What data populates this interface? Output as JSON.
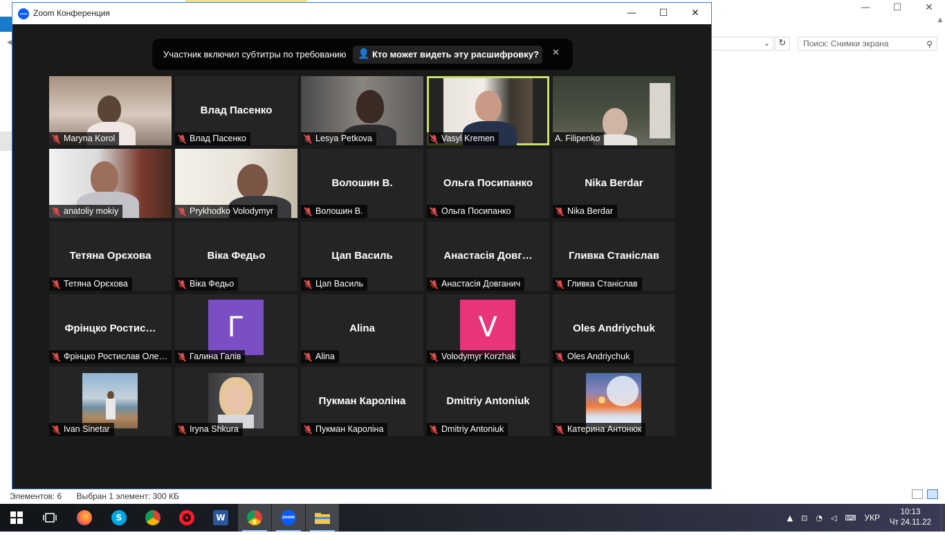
{
  "explorer": {
    "search_placeholder": "Поиск: Снимки экрана",
    "status_items": "Элементов: 6",
    "status_selected": "Выбран 1 элемент: 300 КБ",
    "window_controls": [
      "—",
      "☐",
      "✕"
    ]
  },
  "zoom": {
    "title": "Zoom Конференция",
    "logo_text": "zoom",
    "window_controls": [
      "—",
      "☐",
      "✕"
    ],
    "banner": {
      "text": "Участник включил субтитры по требованию",
      "button": "Кто может видеть эту расшифровку?",
      "close": "✕"
    },
    "participants": [
      {
        "label": "Maryna Korol",
        "tile": "video"
      },
      {
        "label": "Влад Пасенко",
        "display": "Влад Пасенко",
        "tile": "name"
      },
      {
        "label": "Lesya Petkova",
        "tile": "video"
      },
      {
        "label": "Vasyl Kremen",
        "tile": "video",
        "active": true
      },
      {
        "label": "A. Filipenko",
        "tile": "video"
      },
      {
        "label": "anatoliy mokiy",
        "tile": "video"
      },
      {
        "label": "Prykhodko Volodymyr",
        "tile": "video"
      },
      {
        "label": "Волошин В.",
        "display": "Волошин В.",
        "tile": "name"
      },
      {
        "label": "Ольга Посипанко",
        "display": "Ольга Посипанко",
        "tile": "name"
      },
      {
        "label": "Nika Berdar",
        "display": "Nika Berdar",
        "tile": "name"
      },
      {
        "label": "Тетяна Орєхова",
        "display": "Тетяна Орєхова",
        "tile": "name"
      },
      {
        "label": "Віка Федьо",
        "display": "Віка Федьо",
        "tile": "name"
      },
      {
        "label": "Цап Василь",
        "display": "Цап Василь",
        "tile": "name"
      },
      {
        "label": "Анастасія Довганич",
        "display": "Анастасія Довг…",
        "tile": "name"
      },
      {
        "label": "Гливка Станіслав",
        "display": "Гливка Станіслав",
        "tile": "name"
      },
      {
        "label": "Фрінцко Ростислав Оле…",
        "display": "Фрінцко  Ростис…",
        "tile": "name"
      },
      {
        "label": "Галина Галів",
        "letter": "Г",
        "color": "#7b4fc4",
        "tile": "letter"
      },
      {
        "label": "Alina",
        "display": "Alina",
        "tile": "name"
      },
      {
        "label": "Volodymyr Korzhak",
        "letter": "V",
        "color": "#e8357a",
        "tile": "letter"
      },
      {
        "label": "Oles Andriychuk",
        "display": "Oles Andriychuk",
        "tile": "name"
      },
      {
        "label": "Ivan Sinetar",
        "tile": "photo"
      },
      {
        "label": "Iryna Shkura",
        "tile": "photo"
      },
      {
        "label": "Пукман Кароліна",
        "display": "Пукман Кароліна",
        "tile": "name"
      },
      {
        "label": "Dmitriy Antoniuk",
        "display": "Dmitriy Antoniuk",
        "tile": "name"
      },
      {
        "label": "Катерина Антонюк",
        "tile": "photo"
      }
    ]
  },
  "taskbar": {
    "language": "УКР",
    "time": "10:13",
    "date": "Чт 24.11.22",
    "apps": [
      "start",
      "task-view",
      "firefox",
      "skype",
      "chrome",
      "opera",
      "word",
      "chrome-profile",
      "zoom",
      "file-explorer"
    ],
    "zoom_icon_text": "zoom",
    "chrome_profile_badge": "B"
  }
}
